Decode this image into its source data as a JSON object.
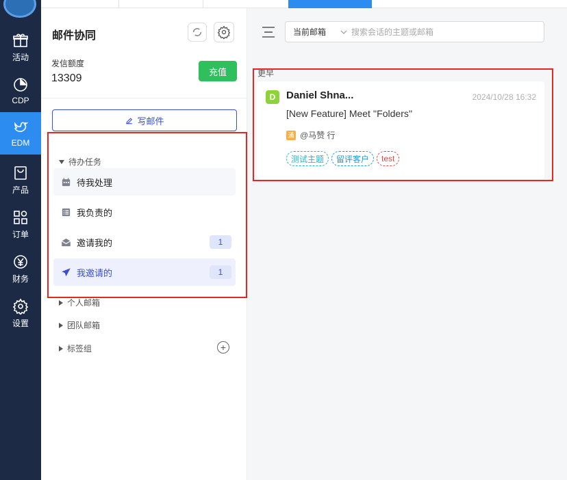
{
  "nav": {
    "items": [
      {
        "label": "活动",
        "icon": "gift-icon"
      },
      {
        "label": "CDP",
        "icon": "pie-chart-icon"
      },
      {
        "label": "EDM",
        "icon": "bird-icon",
        "active": true
      },
      {
        "label": "产品",
        "icon": "shopping-bag-icon"
      },
      {
        "label": "订单",
        "icon": "grid-icon"
      },
      {
        "label": "财务",
        "icon": "yuan-icon"
      },
      {
        "label": "设置",
        "icon": "gear-icon"
      }
    ]
  },
  "panel": {
    "title": "邮件协同",
    "quota_label": "发信额度",
    "quota_value": "13309",
    "recharge_label": "充值",
    "compose_label": "写邮件",
    "todo_group": "待办任务",
    "tasks": [
      {
        "label": "待我处理",
        "icon": "calendar-icon",
        "badge": ""
      },
      {
        "label": "我负责的",
        "icon": "list-icon",
        "badge": ""
      },
      {
        "label": "邀请我的",
        "icon": "mail-icon",
        "badge": "1"
      },
      {
        "label": "我邀请的",
        "icon": "send-icon",
        "badge": "1"
      }
    ],
    "groups": [
      "个人邮箱",
      "团队邮箱",
      "标签组"
    ]
  },
  "search": {
    "scope": "当前邮箱",
    "placeholder": "搜索会话的主题或邮箱"
  },
  "list": {
    "section": "更早",
    "conversation": {
      "avatar": "D",
      "sender": "Daniel Shna...",
      "date": "2024/10/28 16:32",
      "subject": "[New Feature] Meet ''Folders''",
      "assignee_badge": "涌",
      "assignee": "@马赞 行",
      "tags": [
        "测试主题",
        "留评客户",
        "test"
      ]
    }
  },
  "colors": {
    "nav_bg": "#1d2a46",
    "nav_active": "#2d8cf0",
    "accent": "#3a4fd3",
    "recharge": "#2fbf5c",
    "annotation": "#e8261f"
  }
}
